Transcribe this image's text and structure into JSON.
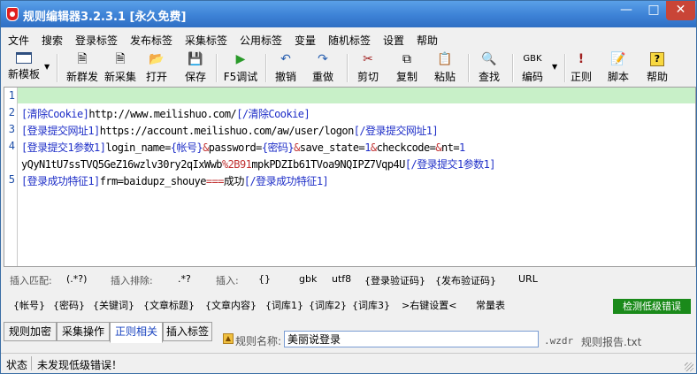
{
  "window": {
    "title": "规则编辑器3.2.3.1 [永久免费]"
  },
  "menu": [
    "文件",
    "搜索",
    "登录标签",
    "发布标签",
    "采集标签",
    "公用标签",
    "变量",
    "随机标签",
    "设置",
    "帮助"
  ],
  "toolbar": {
    "new_template": "新模板",
    "new_publish": "新群发",
    "new_collect": "新采集",
    "open": "打开",
    "save": "保存",
    "debug": "F5调试",
    "undo": "撤销",
    "redo": "重做",
    "cut": "剪切",
    "copy": "复制",
    "paste": "粘贴",
    "find": "查找",
    "encoding": "编码",
    "encoding_value": "GBK",
    "regex": "正则",
    "script": "脚本",
    "help": "帮助"
  },
  "editor": {
    "line_numbers": [
      "1",
      "2",
      "3",
      "4",
      "5"
    ],
    "lines": [
      {
        "segments": []
      },
      {
        "segments": [
          {
            "t": "[清除Cookie]",
            "k": "tag"
          },
          {
            "t": "http://www.meilishuo.com/",
            "k": "text"
          },
          {
            "t": "[/清除Cookie]",
            "k": "tag"
          }
        ]
      },
      {
        "segments": [
          {
            "t": "[登录提交网址1]",
            "k": "tag"
          },
          {
            "t": "https://account.meilishuo.com/aw/user/logon",
            "k": "text"
          },
          {
            "t": "[/登录提交网址1]",
            "k": "tag"
          }
        ]
      },
      {
        "segments": [
          {
            "t": "[登录提交1参数1]",
            "k": "tag"
          },
          {
            "t": "login_name=",
            "k": "text"
          },
          {
            "t": "{帐号}",
            "k": "tag"
          },
          {
            "t": "&",
            "k": "op"
          },
          {
            "t": "password=",
            "k": "text"
          },
          {
            "t": "{密码}",
            "k": "tag"
          },
          {
            "t": "&",
            "k": "op"
          },
          {
            "t": "save_state=",
            "k": "text"
          },
          {
            "t": "1",
            "k": "tag"
          },
          {
            "t": "&",
            "k": "op"
          },
          {
            "t": "checkcode=",
            "k": "text"
          },
          {
            "t": "&",
            "k": "op"
          },
          {
            "t": "nt=",
            "k": "text"
          },
          {
            "t": "1",
            "k": "tag"
          }
        ]
      },
      {
        "segments": [
          {
            "t": "yQyN1tU7ssTVQ5GeZ16wzlv30ry2qIxWwb",
            "k": "text"
          },
          {
            "t": "%2B91",
            "k": "op"
          },
          {
            "t": "mpkPDZIb61TVoa9NQIPZ7Vqp4U",
            "k": "text"
          },
          {
            "t": "[/登录提交1参数1]",
            "k": "tag"
          }
        ]
      },
      {
        "segments": [
          {
            "t": "[登录成功特征1]",
            "k": "tag"
          },
          {
            "t": "frm=baidupz_shouye",
            "k": "text"
          },
          {
            "t": "===",
            "k": "op"
          },
          {
            "t": "成功",
            "k": "text"
          },
          {
            "t": "[/登录成功特征1]",
            "k": "tag"
          }
        ]
      }
    ]
  },
  "insert_row": {
    "match_label": "插入匹配:",
    "match_value": "(.*?)",
    "exclude_label": "插入排除:",
    "exclude_value": ".*?",
    "insert_label": "插入:",
    "braces": "{}",
    "gbk": "gbk",
    "utf8": "utf8",
    "login_captcha": "{登录验证码}",
    "publish_captcha": "{发布验证码}",
    "url": "URL"
  },
  "tag_row": {
    "items": [
      "{帐号}",
      "{密码}",
      "{关键词}",
      "{文章标题}",
      "{文章内容}",
      "{词库1}",
      "{词库2}",
      "{词库3}",
      ">右键设置<",
      "常量表"
    ],
    "check_button": "检测低级错误"
  },
  "tabs": [
    "规则加密",
    "采集操作",
    "正则相关",
    "插入标签"
  ],
  "rule": {
    "name_label": "规则名称:",
    "name_value": "美丽说登录",
    "ext": ".wzdr",
    "report": "规则报告.txt"
  },
  "status": {
    "label": "状态",
    "message": "未发现低级错误！"
  }
}
